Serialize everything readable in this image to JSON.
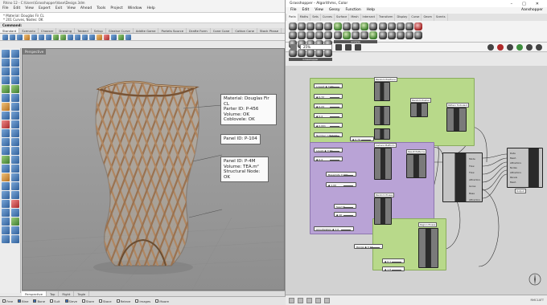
{
  "rhino": {
    "title": "Rhino 12 - C:\\Users\\Grasshopper\\Vase\\Design.3dm",
    "menu": [
      "File",
      "Edit",
      "View",
      "Expert",
      "Exit",
      "View",
      "Ahead",
      "Tools",
      "Project",
      "Window",
      "Help"
    ],
    "command_history": [
      "* Material: Douglas Fir CL",
      "* 201 Curves, Nodes: OK"
    ],
    "command_label": "Command:",
    "toolbar_tabs": [
      "Standard",
      "Scenario",
      "Chooser",
      "Drawing",
      "Tabbed",
      "Setup",
      "Gleatse Curve",
      "Addite Game",
      "Portets Source",
      "Drafte Form",
      "Cone Cone",
      "Cotton Cone",
      "Stack Phase"
    ],
    "viewport_title": "Perspective",
    "viewport_tabs": [
      "Perspective",
      "Top",
      "Right",
      "Tagle"
    ],
    "callouts": {
      "material": [
        "Material: Douglas Fir CL",
        "Parter ID: P-456",
        "Volume: OK",
        "Coblovele: OK"
      ],
      "panel": [
        "Panel ID: P-104"
      ],
      "node": [
        "Panel ID: P-4M",
        "Volume: TEA.m²",
        "Structural Node: OK"
      ]
    },
    "status_items": [
      {
        "label": "Free",
        "checked": false
      },
      {
        "label": "Bine",
        "checked": true
      },
      {
        "label": "Bone",
        "checked": true
      },
      {
        "label": "Suit",
        "checked": false
      },
      {
        "label": "Sleve",
        "checked": true
      },
      {
        "label": "Store",
        "checked": false
      },
      {
        "label": "Stace",
        "checked": false
      },
      {
        "label": "Releve",
        "checked": false
      },
      {
        "label": "Images",
        "checked": false
      },
      {
        "label": "Moore",
        "checked": false
      }
    ]
  },
  "grasshopper": {
    "title": "Grasshopper - Algorithms, Color",
    "window_controls": [
      "–",
      "□",
      "✕"
    ],
    "menu": [
      "File",
      "Edit",
      "View",
      "Gessy",
      "Function",
      "Help"
    ],
    "user": "Aanshopper",
    "tabs": [
      "Parla",
      "Maths",
      "Sets",
      "Curves",
      "Surface",
      "Mesh",
      "Intersect",
      "Transform",
      "Display",
      "Curse",
      "Geom",
      "Scents"
    ],
    "ribbon_groups": [
      "Grasshopper",
      "Analyse"
    ],
    "zoom": "25%",
    "groups": {
      "green_top": {
        "components": [
          "Random Positions",
          "Random Pusher",
          "Pattern Turbulent"
        ],
        "sliders": [
          "Lowest ◆ 0.10",
          "◆ 0.72",
          "◆ 0.24",
          "◆ 0.4",
          "◆ 0.001",
          "Number cult 0.11",
          "◆ 0.79"
        ]
      },
      "purple": {
        "components": [
          "Camera Platform",
          "Result Patterns",
          "Random Pluses"
        ],
        "sliders": [
          "Levels ◆ 0.37",
          "◆ 0.4",
          "Baseplate 0.000",
          "◆ 1.00",
          "Seed ◆",
          "◆ 10",
          "Amortization ◆ 1.0"
        ]
      },
      "green_bottom": {
        "components": [
          "Region Pluses"
        ],
        "sliders": [
          "Range ◆ 0.13",
          "◆ 0.1",
          "◆ 1.8"
        ]
      }
    },
    "cluster_outputs": [
      "Mode",
      "Flow",
      "Flow",
      "Attractors",
      "Gorse",
      "Base",
      "Attractors"
    ],
    "final_outputs": [
      "Data",
      "Mesh",
      "Attractors",
      "Nodes",
      "Attractors",
      "Panels",
      "Mesh"
    ],
    "final_label": "Output",
    "status": "RMC1ATT"
  },
  "colors": {
    "group_green": "#b8d98a",
    "group_purple": "#b9a3d6",
    "wood": "#b89068"
  }
}
